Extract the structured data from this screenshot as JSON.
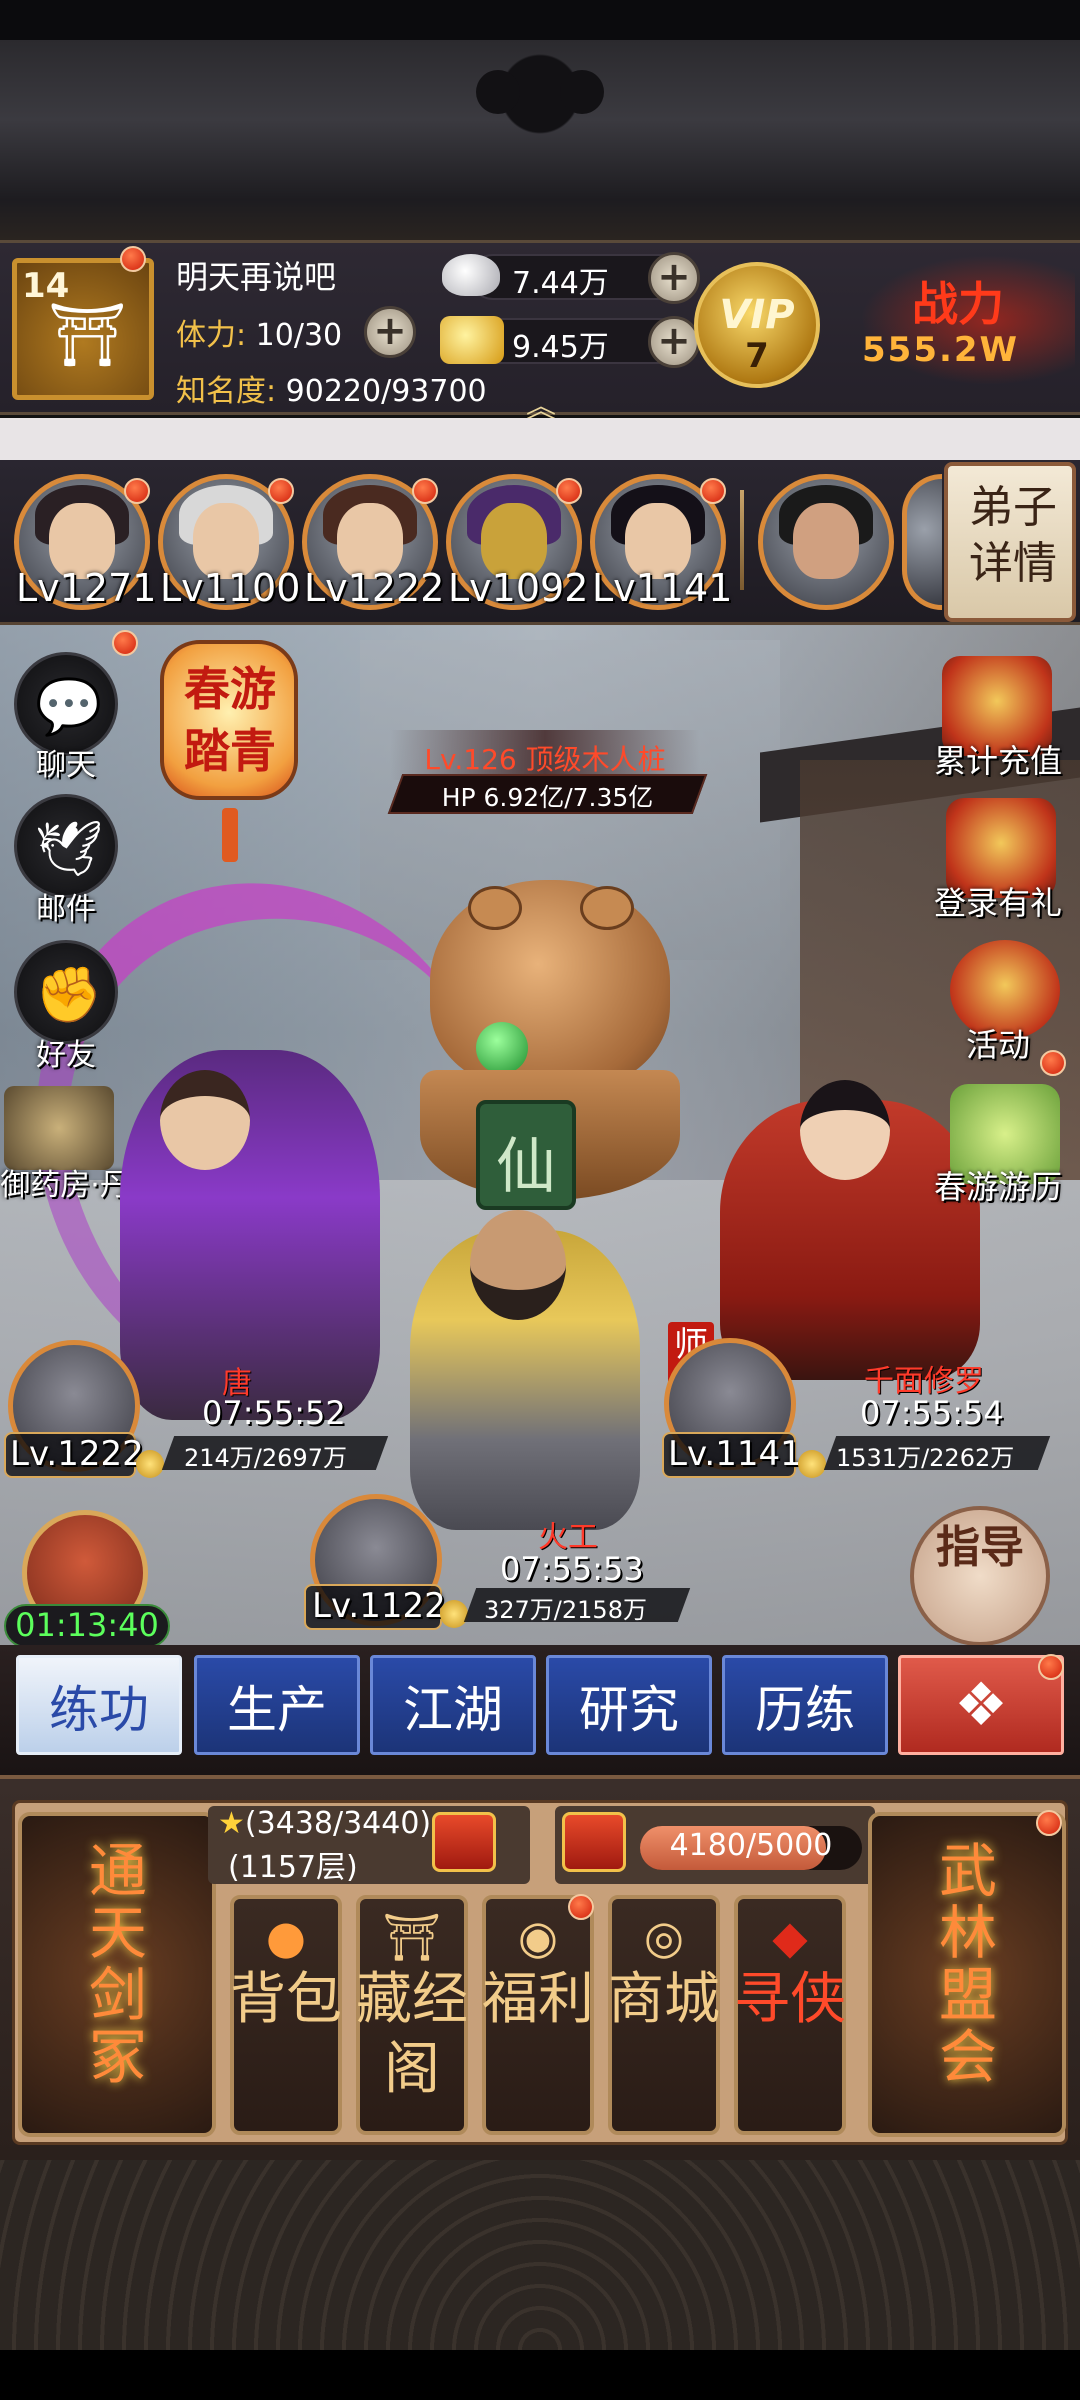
{
  "player": {
    "level": "14",
    "name": "明天再说吧",
    "stamina_label": "体力:",
    "stamina_value": "10/30",
    "fame_label": "知名度:",
    "fame_value": "90220/93700"
  },
  "resources": {
    "silver": "7.44万",
    "gold": "9.45万"
  },
  "vip": {
    "label": "VIP",
    "level": "7"
  },
  "combat_power": {
    "label": "战力",
    "value": "555.2W"
  },
  "heroes": [
    {
      "level": "Lv1271"
    },
    {
      "level": "Lv1100"
    },
    {
      "level": "Lv1222"
    },
    {
      "level": "Lv1092"
    },
    {
      "level": "Lv1141"
    }
  ],
  "disciple_button": "弟子详情",
  "left_menu": {
    "chat": "聊天",
    "mail": "邮件",
    "friends": "好友",
    "pharmacy": "御药房·丹"
  },
  "event_lantern": "春游踏青",
  "right_menu": {
    "recharge": "累计充值",
    "login_gift": "登录有礼",
    "activity": "活动",
    "spring_tour": "春游游历"
  },
  "boss": {
    "name": "Lv.126 顶级木人桩",
    "hp": "HP 6.92亿/7.35亿",
    "glyph": "仙"
  },
  "units": {
    "left": {
      "level": "Lv.1222",
      "name": "唐",
      "time": "07:55:52",
      "progress": "214万/2697万"
    },
    "right": {
      "level": "Lv.1141",
      "name": "千面修罗",
      "time": "07:55:54",
      "progress": "1531万/2262万",
      "tag": "师兄"
    },
    "center": {
      "level": "Lv.1122",
      "name": "火工",
      "time": "07:55:53",
      "progress": "327万/2158万"
    }
  },
  "timer": "01:13:40",
  "guide": "指导",
  "tabs": [
    "练功",
    "生产",
    "江湖",
    "研究",
    "历练"
  ],
  "panel": {
    "stars": "(3438/3440)",
    "floor": "(1157层)",
    "progress_text": "4180/5000",
    "progress_fraction": 0.836,
    "left_big": "通天剑冢",
    "right_big": "武林盟会",
    "cards": [
      "背包",
      "藏经阁",
      "福利",
      "商城",
      "寻侠"
    ]
  },
  "colors": {
    "accent_gold": "#f2c14a",
    "tab_blue": "#2a4aa8",
    "alert_red": "#d01e0a"
  }
}
